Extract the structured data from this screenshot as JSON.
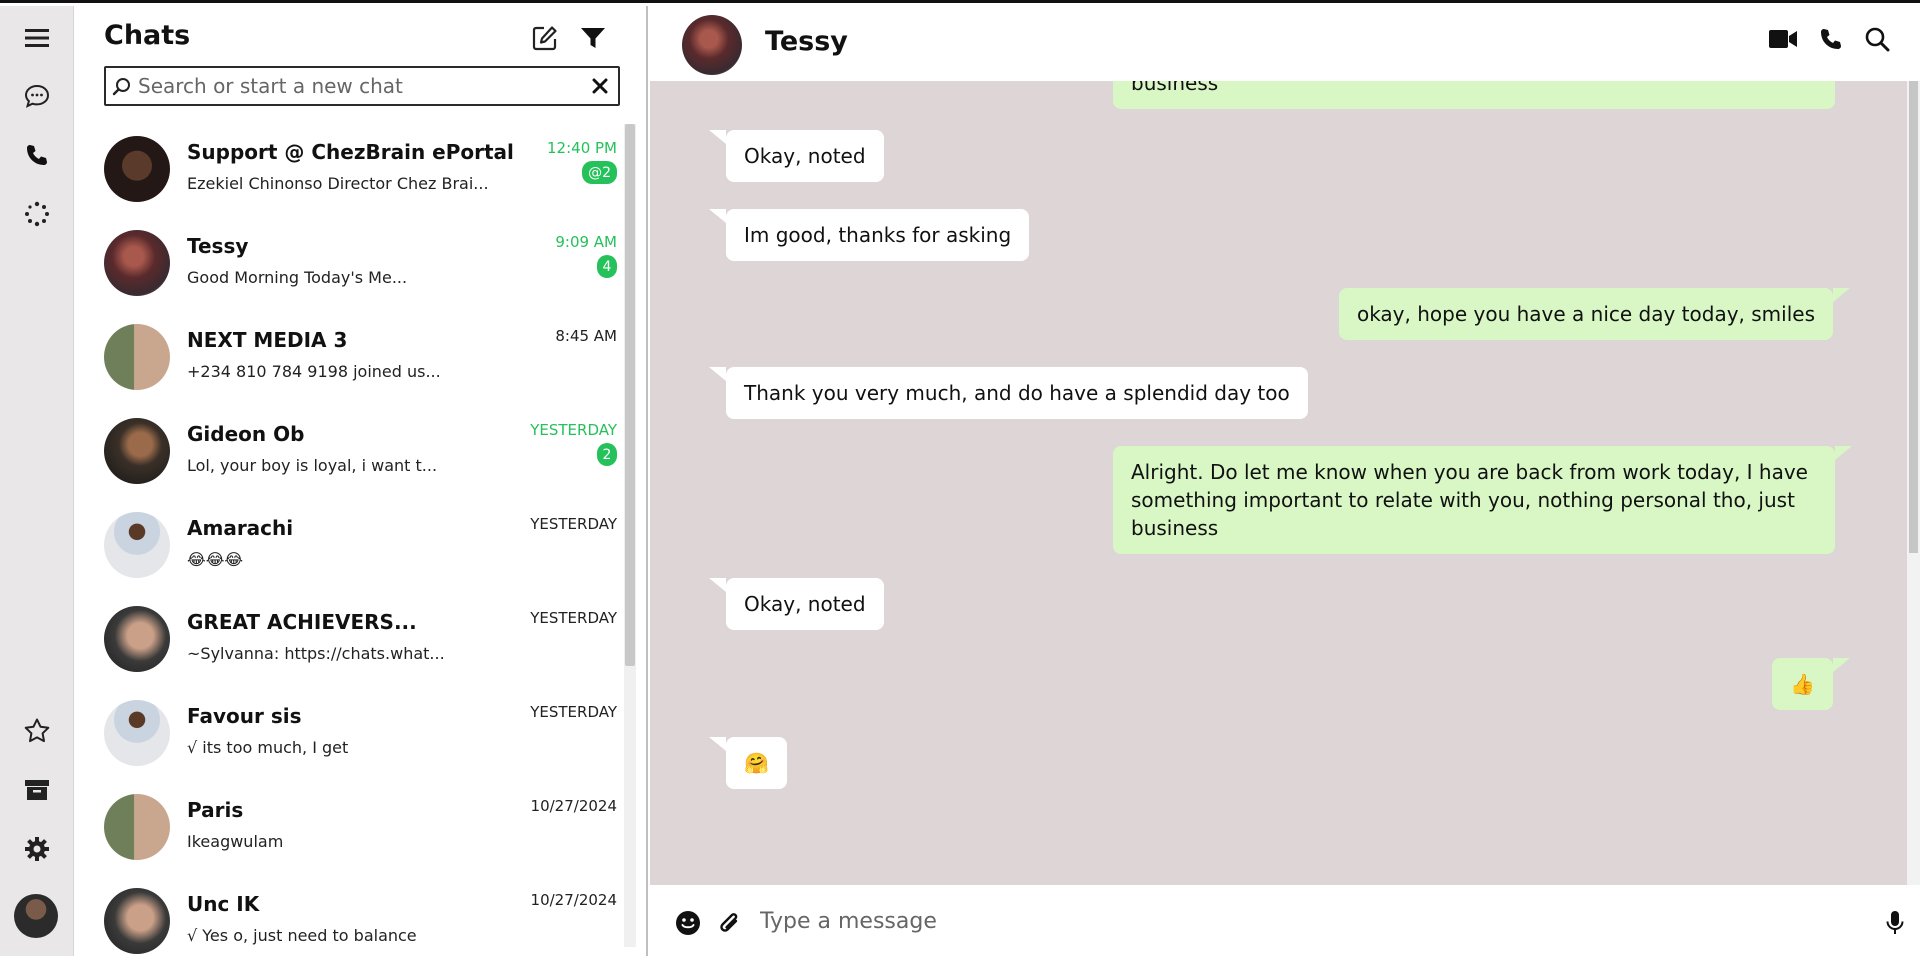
{
  "rail": {
    "items": [
      {
        "icon": "menu-icon"
      },
      {
        "icon": "chats-icon"
      },
      {
        "icon": "calls-icon"
      },
      {
        "icon": "status-icon"
      }
    ],
    "bottom_items": [
      {
        "icon": "star-icon"
      },
      {
        "icon": "archive-icon"
      },
      {
        "icon": "gear-icon"
      }
    ]
  },
  "chat_list": {
    "title": "Chats",
    "search": {
      "placeholder": "Search or start a new chat",
      "value": ""
    },
    "items": [
      {
        "name": "Support @ ChezBrain ePortal",
        "preview": "Ezekiel Chinonso Director Chez Brai...",
        "time": "12:40 PM",
        "unread": true,
        "badge": "@2"
      },
      {
        "name": "Tessy",
        "preview": "Good Morning Today's Me...",
        "time": "9:09 AM",
        "unread": true,
        "badge": "4"
      },
      {
        "name": "NEXT MEDIA 3",
        "preview": "+234 810 784 9198 joined us...",
        "time": "8:45 AM",
        "unread": false,
        "badge": ""
      },
      {
        "name": "Gideon Ob",
        "preview": "Lol, your boy is loyal, i want t...",
        "time": "YESTERDAY",
        "unread": true,
        "badge": "2"
      },
      {
        "name": "Amarachi",
        "preview": "😂😂😂",
        "time": "YESTERDAY",
        "unread": false,
        "badge": ""
      },
      {
        "name": "GREAT ACHIEVERS...",
        "preview": "~Sylvanna: https://chats.what...",
        "time": "YESTERDAY",
        "unread": false,
        "badge": ""
      },
      {
        "name": "Favour sis",
        "preview": "√ its too much, I get",
        "time": "YESTERDAY",
        "unread": false,
        "badge": ""
      },
      {
        "name": "Paris",
        "preview": "Ikeagwulam",
        "time": "10/27/2024",
        "unread": false,
        "badge": ""
      },
      {
        "name": "Unc IK",
        "preview": "√ Yes o, just need to balance",
        "time": "10/27/2024",
        "unread": false,
        "badge": ""
      }
    ]
  },
  "conversation": {
    "contact_name": "Tessy",
    "messages": [
      {
        "dir": "out",
        "text": "business"
      },
      {
        "dir": "in",
        "text": "Okay, noted"
      },
      {
        "dir": "in",
        "text": "Im good, thanks for asking"
      },
      {
        "dir": "out",
        "text": "okay, hope you have a nice day today, smiles"
      },
      {
        "dir": "in",
        "text": "Thank you very much, and do have a splendid day too"
      },
      {
        "dir": "out",
        "text": "Alright. Do let me know when you are back from work today, I have something important to relate with you, nothing personal tho, just business"
      },
      {
        "dir": "in",
        "text": "Okay, noted"
      },
      {
        "dir": "out",
        "text": "👍"
      },
      {
        "dir": "in",
        "text": "🤗"
      }
    ],
    "composer": {
      "placeholder": "Type a message",
      "value": ""
    }
  },
  "colors": {
    "accent_green": "#25c15a",
    "outgoing_bubble": "#d8f7c5",
    "incoming_bubble": "#ffffff",
    "chat_background": "#ddd5d6",
    "rail_background": "#e9e7e8"
  }
}
